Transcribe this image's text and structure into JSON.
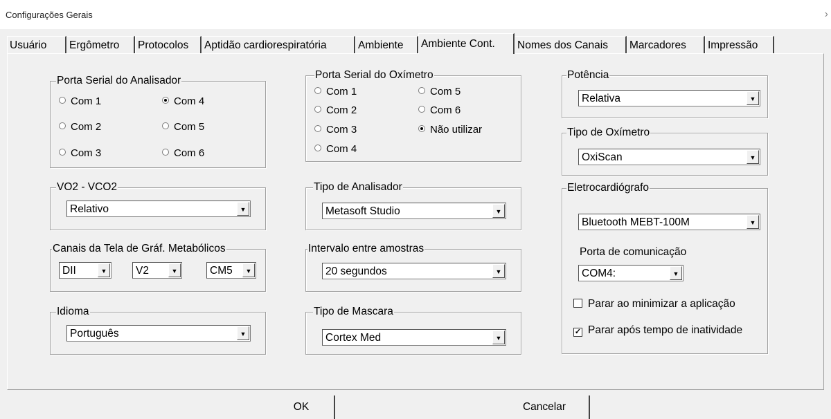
{
  "window": {
    "title": "Configurações Gerais",
    "close_glyph": "›"
  },
  "tabs": [
    {
      "label": "Usuário"
    },
    {
      "label": "Ergômetro"
    },
    {
      "label": "Protocolos"
    },
    {
      "label": "Aptidão cardiorespiratória"
    },
    {
      "label": "Ambiente"
    },
    {
      "label": "Ambiente Cont."
    },
    {
      "label": "Nomes dos Canais"
    },
    {
      "label": "Marcadores"
    },
    {
      "label": "Impressão"
    }
  ],
  "active_tab": "Ambiente Cont.",
  "analyzer_port": {
    "title": "Porta Serial do Analisador",
    "options": [
      "Com 1",
      "Com 2",
      "Com 3",
      "Com 4",
      "Com 5",
      "Com 6"
    ],
    "selected": "Com 4"
  },
  "oximeter_port": {
    "title": "Porta Serial do Oxímetro",
    "options": [
      "Com 1",
      "Com 2",
      "Com 3",
      "Com 4",
      "Com 5",
      "Com 6",
      "Não utilizar"
    ],
    "selected": "Não utilizar"
  },
  "power": {
    "title": "Potência",
    "value": "Relativa"
  },
  "oximeter_type": {
    "title": "Tipo de Oxímetro",
    "value": "OxiScan"
  },
  "vo2": {
    "title": "VO2 - VCO2",
    "value": "Relativo"
  },
  "analyzer_type": {
    "title": "Tipo de Analisador",
    "value": "Metasoft Studio"
  },
  "channels": {
    "title": "Canais da Tela de Gráf. Metabólicos",
    "values": [
      "DII",
      "V2",
      "CM5"
    ]
  },
  "interval": {
    "title": "Intervalo entre amostras",
    "value": "20 segundos"
  },
  "language": {
    "title": "Idioma",
    "value": "Português"
  },
  "mask": {
    "title": "Tipo de Mascara",
    "value": "Cortex Med"
  },
  "ecg": {
    "title": "Eletrocardiógrafo",
    "device": "Bluetooth MEBT-100M",
    "port_label": "Porta de comunicação",
    "port_value": "COM4:",
    "stop_minimize_label": "Parar ao minimizar  a aplicação",
    "stop_minimize_checked": false,
    "stop_idle_label": "Parar após tempo de inatividade",
    "stop_idle_checked": true
  },
  "dropdown_arrow": "▼",
  "check_mark": "✓",
  "buttons": {
    "ok": "OK",
    "cancel": "Cancelar"
  }
}
